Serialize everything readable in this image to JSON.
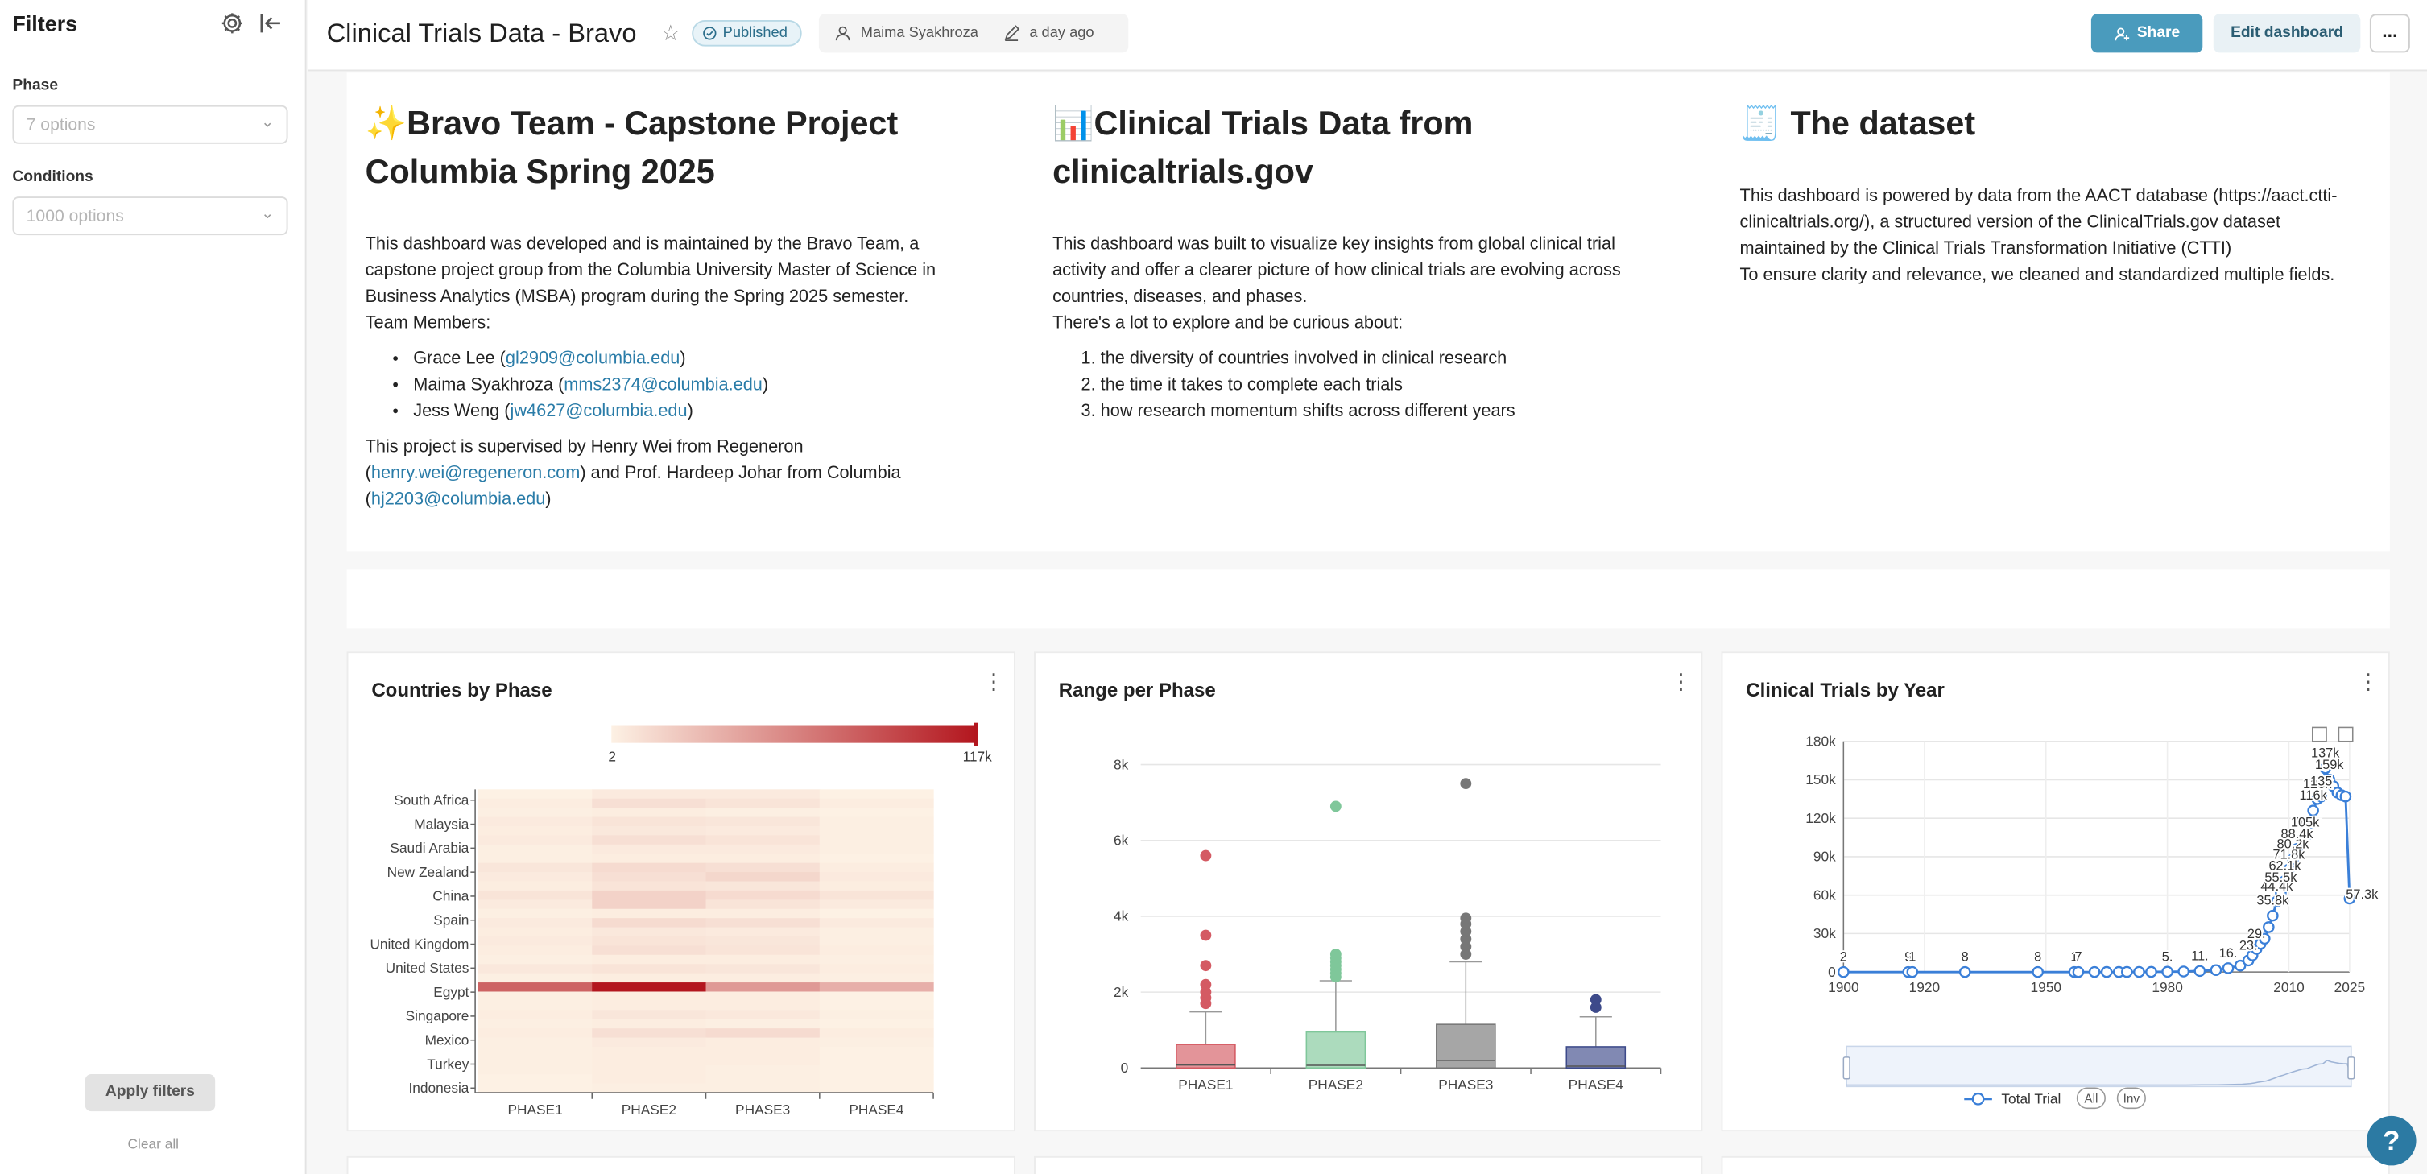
{
  "sidebar": {
    "title": "Filters",
    "filters": [
      {
        "label": "Phase",
        "placeholder": "7 options"
      },
      {
        "label": "Conditions",
        "placeholder": "1000 options"
      }
    ],
    "apply_label": "Apply filters",
    "clear_label": "Clear all"
  },
  "header": {
    "title": "Clinical Trials Data - Bravo",
    "status": "Published",
    "owner": "Maima Syakhroza",
    "modified": "a day ago",
    "share_label": "Share",
    "edit_label": "Edit dashboard",
    "more_label": "..."
  },
  "intro": {
    "col1": {
      "heading": "✨Bravo Team - Capstone Project Columbia Spring 2025",
      "para1": "This dashboard was developed and is maintained by the Bravo Team, a capstone project group from the Columbia University Master of Science in Business Analytics (MSBA) program during the Spring 2025 semester.",
      "members_label": "Team Members:",
      "members": [
        {
          "name": "Grace Lee",
          "email": "gl2909@columbia.edu"
        },
        {
          "name": "Maima Syakhroza",
          "email": "mms2374@columbia.edu"
        },
        {
          "name": "Jess Weng",
          "email": "jw4627@columbia.edu"
        }
      ],
      "supervision_prefix": "This project is supervised by Henry Wei from Regeneron (",
      "supervisor1_email": "henry.wei@regeneron.com",
      "supervision_mid": ") and Prof. Hardeep Johar from Columbia (",
      "supervisor2_email": "hj2203@columbia.edu",
      "supervision_suffix": ")"
    },
    "col2": {
      "heading": "📊Clinical Trials Data from clinicaltrials.gov",
      "para1": "This dashboard was built to visualize key insights from global clinical trial activity and offer a clearer picture of how clinical trials are evolving across countries, diseases, and phases.",
      "para2": "There's a lot to explore and be curious about:",
      "items": [
        "the diversity of countries involved in clinical research",
        "the time it takes to complete each trials",
        "how research momentum shifts across different years"
      ]
    },
    "col3": {
      "heading": "🧾 The dataset",
      "para1": "This dashboard is powered by data from the AACT database (https://aact.ctti-clinicaltrials.org/), a structured version of the ClinicalTrials.gov dataset maintained by the Clinical Trials Transformation Initiative (CTTI)",
      "para2": "To ensure clarity and relevance, we cleaned and standardized multiple fields."
    }
  },
  "cards": {
    "heatmap_title": "Countries by Phase",
    "boxplot_title": "Range per Phase",
    "line_title": "Clinical Trials by Year"
  },
  "chart_data": [
    {
      "type": "heatmap",
      "title": "Countries by Phase",
      "scale_min_label": "2",
      "scale_max_label": "117k",
      "colors": {
        "low": "#fdf1e4",
        "high": "#b3161e"
      },
      "x": [
        "PHASE1",
        "PHASE2",
        "PHASE3",
        "PHASE4"
      ],
      "y_labels": [
        "South Africa",
        "Malaysia",
        "Saudi Arabia",
        "New Zealand",
        "China",
        "Spain",
        "United Kingdom",
        "United States",
        "Egypt",
        "Singapore",
        "Mexico",
        "Turkey",
        "Indonesia"
      ],
      "band_intensity": [
        [
          0.0,
          0.03,
          0.03,
          0.0
        ],
        [
          0.02,
          0.08,
          0.06,
          0.02
        ],
        [
          0.01,
          0.02,
          0.01,
          0.0
        ],
        [
          0.03,
          0.06,
          0.05,
          0.01
        ],
        [
          0.02,
          0.04,
          0.03,
          0.01
        ],
        [
          0.03,
          0.08,
          0.06,
          0.01
        ],
        [
          0.01,
          0.03,
          0.03,
          0.01
        ],
        [
          0.01,
          0.02,
          0.02,
          0.0
        ],
        [
          0.05,
          0.1,
          0.08,
          0.02
        ],
        [
          0.03,
          0.08,
          0.12,
          0.03
        ],
        [
          0.02,
          0.06,
          0.05,
          0.02
        ],
        [
          0.06,
          0.14,
          0.1,
          0.06
        ],
        [
          0.03,
          0.14,
          0.06,
          0.03
        ],
        [
          0.01,
          0.02,
          0.02,
          0.0
        ],
        [
          0.03,
          0.1,
          0.08,
          0.03
        ],
        [
          0.02,
          0.04,
          0.03,
          0.01
        ],
        [
          0.03,
          0.06,
          0.05,
          0.01
        ],
        [
          0.02,
          0.08,
          0.06,
          0.02
        ],
        [
          0.01,
          0.02,
          0.02,
          0.01
        ],
        [
          0.04,
          0.06,
          0.05,
          0.02
        ],
        [
          0.01,
          0.02,
          0.02,
          0.01
        ],
        [
          0.65,
          1.0,
          0.4,
          0.3
        ],
        [
          0.01,
          0.02,
          0.02,
          0.0
        ],
        [
          0.01,
          0.02,
          0.02,
          0.0
        ],
        [
          0.02,
          0.05,
          0.04,
          0.01
        ],
        [
          0.01,
          0.02,
          0.01,
          0.0
        ],
        [
          0.02,
          0.08,
          0.1,
          0.02
        ],
        [
          0.01,
          0.03,
          0.02,
          0.01
        ],
        [
          0.01,
          0.02,
          0.02,
          0.0
        ],
        [
          0.01,
          0.02,
          0.02,
          0.0
        ],
        [
          0.01,
          0.02,
          0.01,
          0.0
        ],
        [
          0.0,
          0.02,
          0.01,
          0.0
        ],
        [
          0.0,
          0.01,
          0.01,
          0.0
        ]
      ]
    },
    {
      "type": "box",
      "title": "Range per Phase",
      "categories": [
        "PHASE1",
        "PHASE2",
        "PHASE3",
        "PHASE4"
      ],
      "y_ticks": [
        "0",
        "2k",
        "4k",
        "6k",
        "8k"
      ],
      "ylim": [
        0,
        8000
      ],
      "series": [
        {
          "color": "#d45a63",
          "q1": 0,
          "median": 80,
          "q3": 620,
          "whisker_low": 0,
          "whisker_high": 1480,
          "outliers": [
            1700,
            1850,
            2000,
            2200,
            2700,
            3500,
            5600
          ]
        },
        {
          "color": "#7fc79a",
          "q1": 0,
          "median": 70,
          "q3": 950,
          "whisker_low": 0,
          "whisker_high": 2300,
          "outliers": [
            2400,
            2500,
            2600,
            2700,
            2800,
            2900,
            3000,
            6900
          ]
        },
        {
          "color": "#777777",
          "q1": 0,
          "median": 200,
          "q3": 1150,
          "whisker_low": 0,
          "whisker_high": 2800,
          "outliers": [
            3000,
            3200,
            3400,
            3600,
            3800,
            3950,
            7500
          ]
        },
        {
          "color": "#3d4a8a",
          "q1": 0,
          "median": 50,
          "q3": 560,
          "whisker_low": 0,
          "whisker_high": 1350,
          "outliers": [
            1600,
            1800
          ]
        }
      ]
    },
    {
      "type": "line",
      "title": "Clinical Trials by Year",
      "series_name": "Total Trial",
      "color": "#3a7fd8",
      "x_ticks": [
        "1900",
        "1920",
        "1950",
        "1980",
        "2010",
        "2025"
      ],
      "y_ticks": [
        "0",
        "30k",
        "60k",
        "90k",
        "120k",
        "150k",
        "180k"
      ],
      "xlim": [
        1900,
        2025
      ],
      "ylim": [
        0,
        180000
      ],
      "points": [
        [
          1900,
          2
        ],
        [
          1916,
          9
        ],
        [
          1917,
          1
        ],
        [
          1930,
          8
        ],
        [
          1948,
          8
        ],
        [
          1957,
          1
        ],
        [
          1958,
          7
        ],
        [
          1962,
          10
        ],
        [
          1965,
          20
        ],
        [
          1968,
          40
        ],
        [
          1970,
          60
        ],
        [
          1973,
          80
        ],
        [
          1976,
          100
        ],
        [
          1980,
          200
        ],
        [
          1984,
          400
        ],
        [
          1988,
          800
        ],
        [
          1992,
          1500
        ],
        [
          1995,
          3000
        ],
        [
          1998,
          5000
        ],
        [
          2000,
          9000
        ],
        [
          2001,
          13000
        ],
        [
          2002,
          18000
        ],
        [
          2003,
          22000
        ],
        [
          2004,
          26000
        ],
        [
          2005,
          35000
        ],
        [
          2006,
          44000
        ],
        [
          2007,
          55000
        ],
        [
          2008,
          62000
        ],
        [
          2009,
          71000
        ],
        [
          2010,
          80000
        ],
        [
          2011,
          88000
        ],
        [
          2012,
          96000
        ],
        [
          2013,
          103000
        ],
        [
          2014,
          105000
        ],
        [
          2015,
          116000
        ],
        [
          2016,
          126000
        ],
        [
          2017,
          135000
        ],
        [
          2018,
          137000
        ],
        [
          2019,
          159000
        ],
        [
          2020,
          150000
        ],
        [
          2021,
          145000
        ],
        [
          2022,
          140000
        ],
        [
          2023,
          138000
        ],
        [
          2024,
          137000
        ],
        [
          2025,
          57300
        ]
      ],
      "value_labels": [
        "2",
        "9",
        "1",
        "8",
        "8",
        "1",
        "7",
        "5.",
        "11.",
        "16.",
        "23.",
        "29.",
        "35.8k",
        "44.4k",
        "55.5k",
        "62.1k",
        "71.8k",
        "80.2k",
        "88.4k",
        "102",
        "105k",
        "116k",
        "126k",
        "135",
        "137k",
        "159k",
        "57.3k"
      ],
      "legend_buttons": [
        "All",
        "Inv"
      ]
    }
  ],
  "help_label": "?"
}
